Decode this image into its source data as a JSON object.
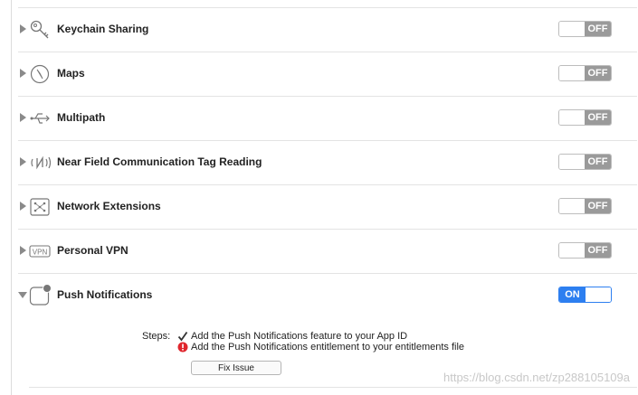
{
  "capabilities": [
    {
      "label": "Keychain Sharing",
      "toggle": "OFF",
      "icon": "key-icon",
      "expanded": false
    },
    {
      "label": "Maps",
      "toggle": "OFF",
      "icon": "compass-icon",
      "expanded": false
    },
    {
      "label": "Multipath",
      "toggle": "OFF",
      "icon": "usb-multipath-icon",
      "expanded": false
    },
    {
      "label": "Near Field Communication Tag Reading",
      "toggle": "OFF",
      "icon": "nfc-icon",
      "expanded": false
    },
    {
      "label": "Network Extensions",
      "toggle": "OFF",
      "icon": "network-extensions-icon",
      "expanded": false
    },
    {
      "label": "Personal VPN",
      "toggle": "OFF",
      "icon": "vpn-icon",
      "expanded": false
    },
    {
      "label": "Push Notifications",
      "toggle": "ON",
      "icon": "push-notification-icon",
      "expanded": true
    }
  ],
  "steps": {
    "label": "Steps:",
    "items": [
      {
        "text": "Add the Push Notifications feature to your App ID",
        "status": "done"
      },
      {
        "text": "Add the Push Notifications entitlement to your entitlements file",
        "status": "error"
      }
    ],
    "fix_button": "Fix Issue"
  },
  "watermark": "https://blog.csdn.net/zp288105109a",
  "colors": {
    "accent": "#2d7ff0",
    "off": "#9a9a9a",
    "error": "#e0262d"
  }
}
